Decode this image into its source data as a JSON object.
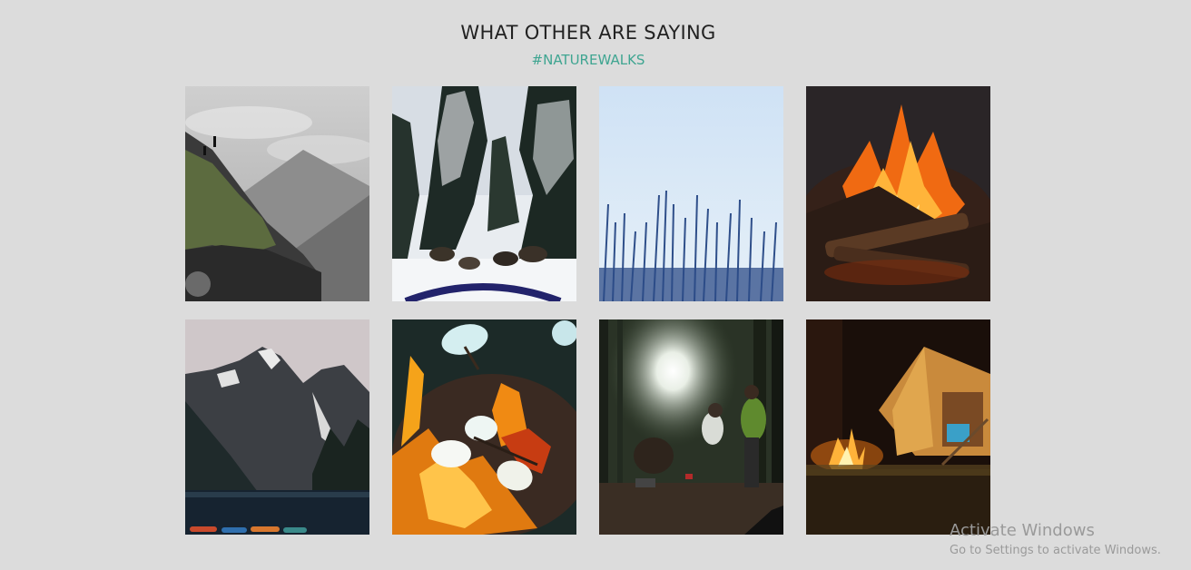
{
  "section": {
    "title": "WHAT OTHER ARE SAYING",
    "hashtag": "#NATUREWALKS"
  },
  "gallery": {
    "photos": [
      {
        "subject": "black and white mountain ridge with hikers"
      },
      {
        "subject": "dog sled team on snowy forest trail"
      },
      {
        "subject": "bare blue treetops against pale sky"
      },
      {
        "subject": "campfire burning logs at night"
      },
      {
        "subject": "snowy mountain peaks above lake with kayaks"
      },
      {
        "subject": "roasting marshmallows over fire"
      },
      {
        "subject": "people camping in forest with sunlight"
      },
      {
        "subject": "tent with campfire at night"
      }
    ]
  },
  "watermark": {
    "title": "Activate Windows",
    "subtitle": "Go to Settings to activate Windows."
  },
  "colors": {
    "background": "#dcdcdc",
    "title": "#222222",
    "hashtag": "#3fa591"
  }
}
